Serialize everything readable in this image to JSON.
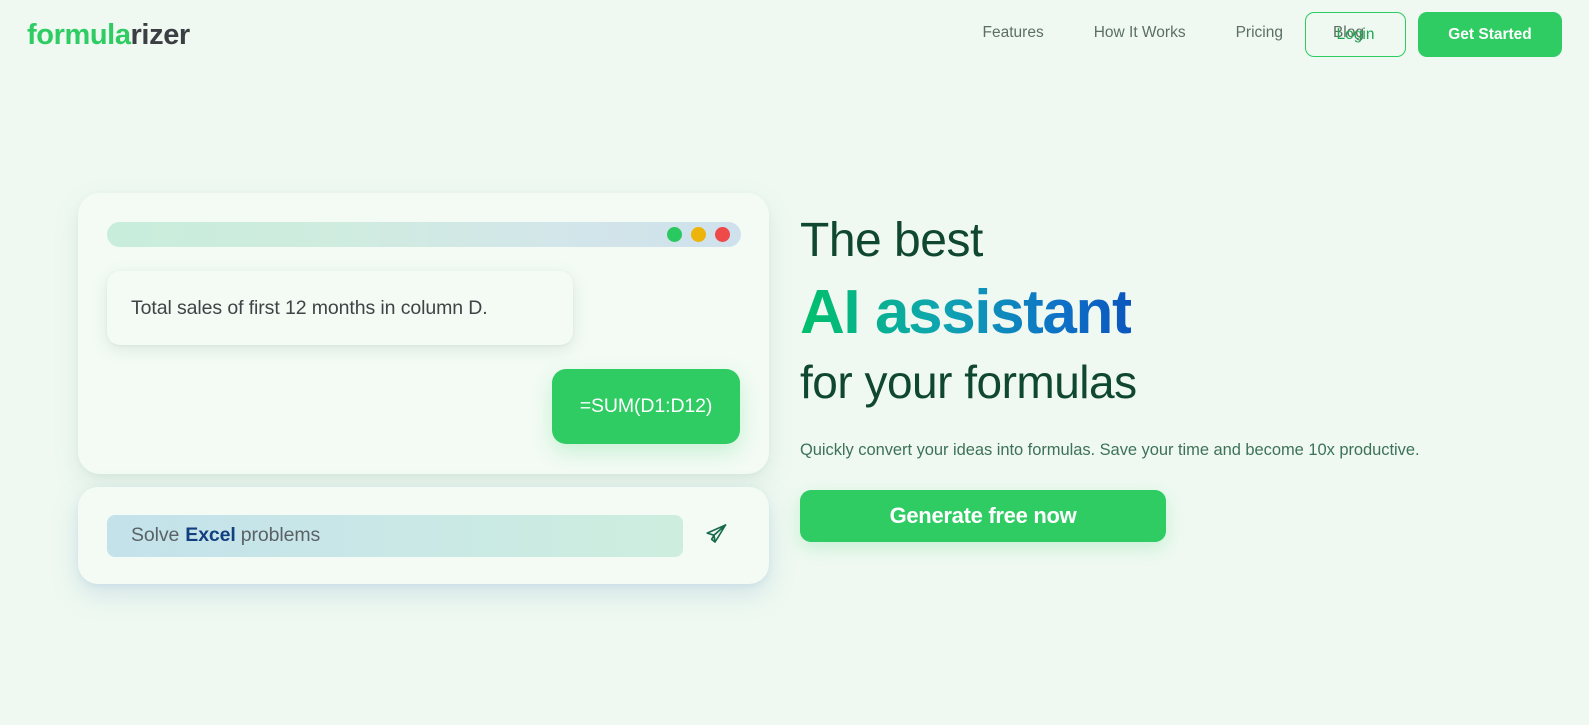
{
  "header": {
    "logo": {
      "part_green": "formula",
      "part_dark": "rizer"
    },
    "nav": [
      {
        "label": "Features"
      },
      {
        "label": "How It Works"
      },
      {
        "label": "Pricing"
      },
      {
        "label": "Blog"
      }
    ],
    "login_label": "Login",
    "get_started_label": "Get Started",
    "accent_color": "#2ECC62",
    "login_text_color": "#21a551"
  },
  "demo": {
    "window_dots": [
      {
        "name": "green",
        "color": "#29c95f"
      },
      {
        "name": "yellow",
        "color": "#edb40c"
      },
      {
        "name": "red",
        "color": "#ef4a4a"
      }
    ],
    "user_message": "Total sales of first 12 months in column D.",
    "bot_message": "=SUM(D1:D12)",
    "input": {
      "prefix": "Solve",
      "keyword": "Excel",
      "suffix": "problems",
      "placeholder": "Solve Excel problems",
      "send_icon": "send-paper-plane-icon"
    }
  },
  "hero": {
    "line1": "The best",
    "line2": "AI assistant",
    "line3": "for your formulas",
    "description": "Quickly convert your ideas into formulas. Save your time and become 10x productive.",
    "cta_label": "Generate free now",
    "gradient_from": "#00c06a",
    "gradient_mid": "#0fa5b0",
    "gradient_to": "#0b56bd"
  }
}
